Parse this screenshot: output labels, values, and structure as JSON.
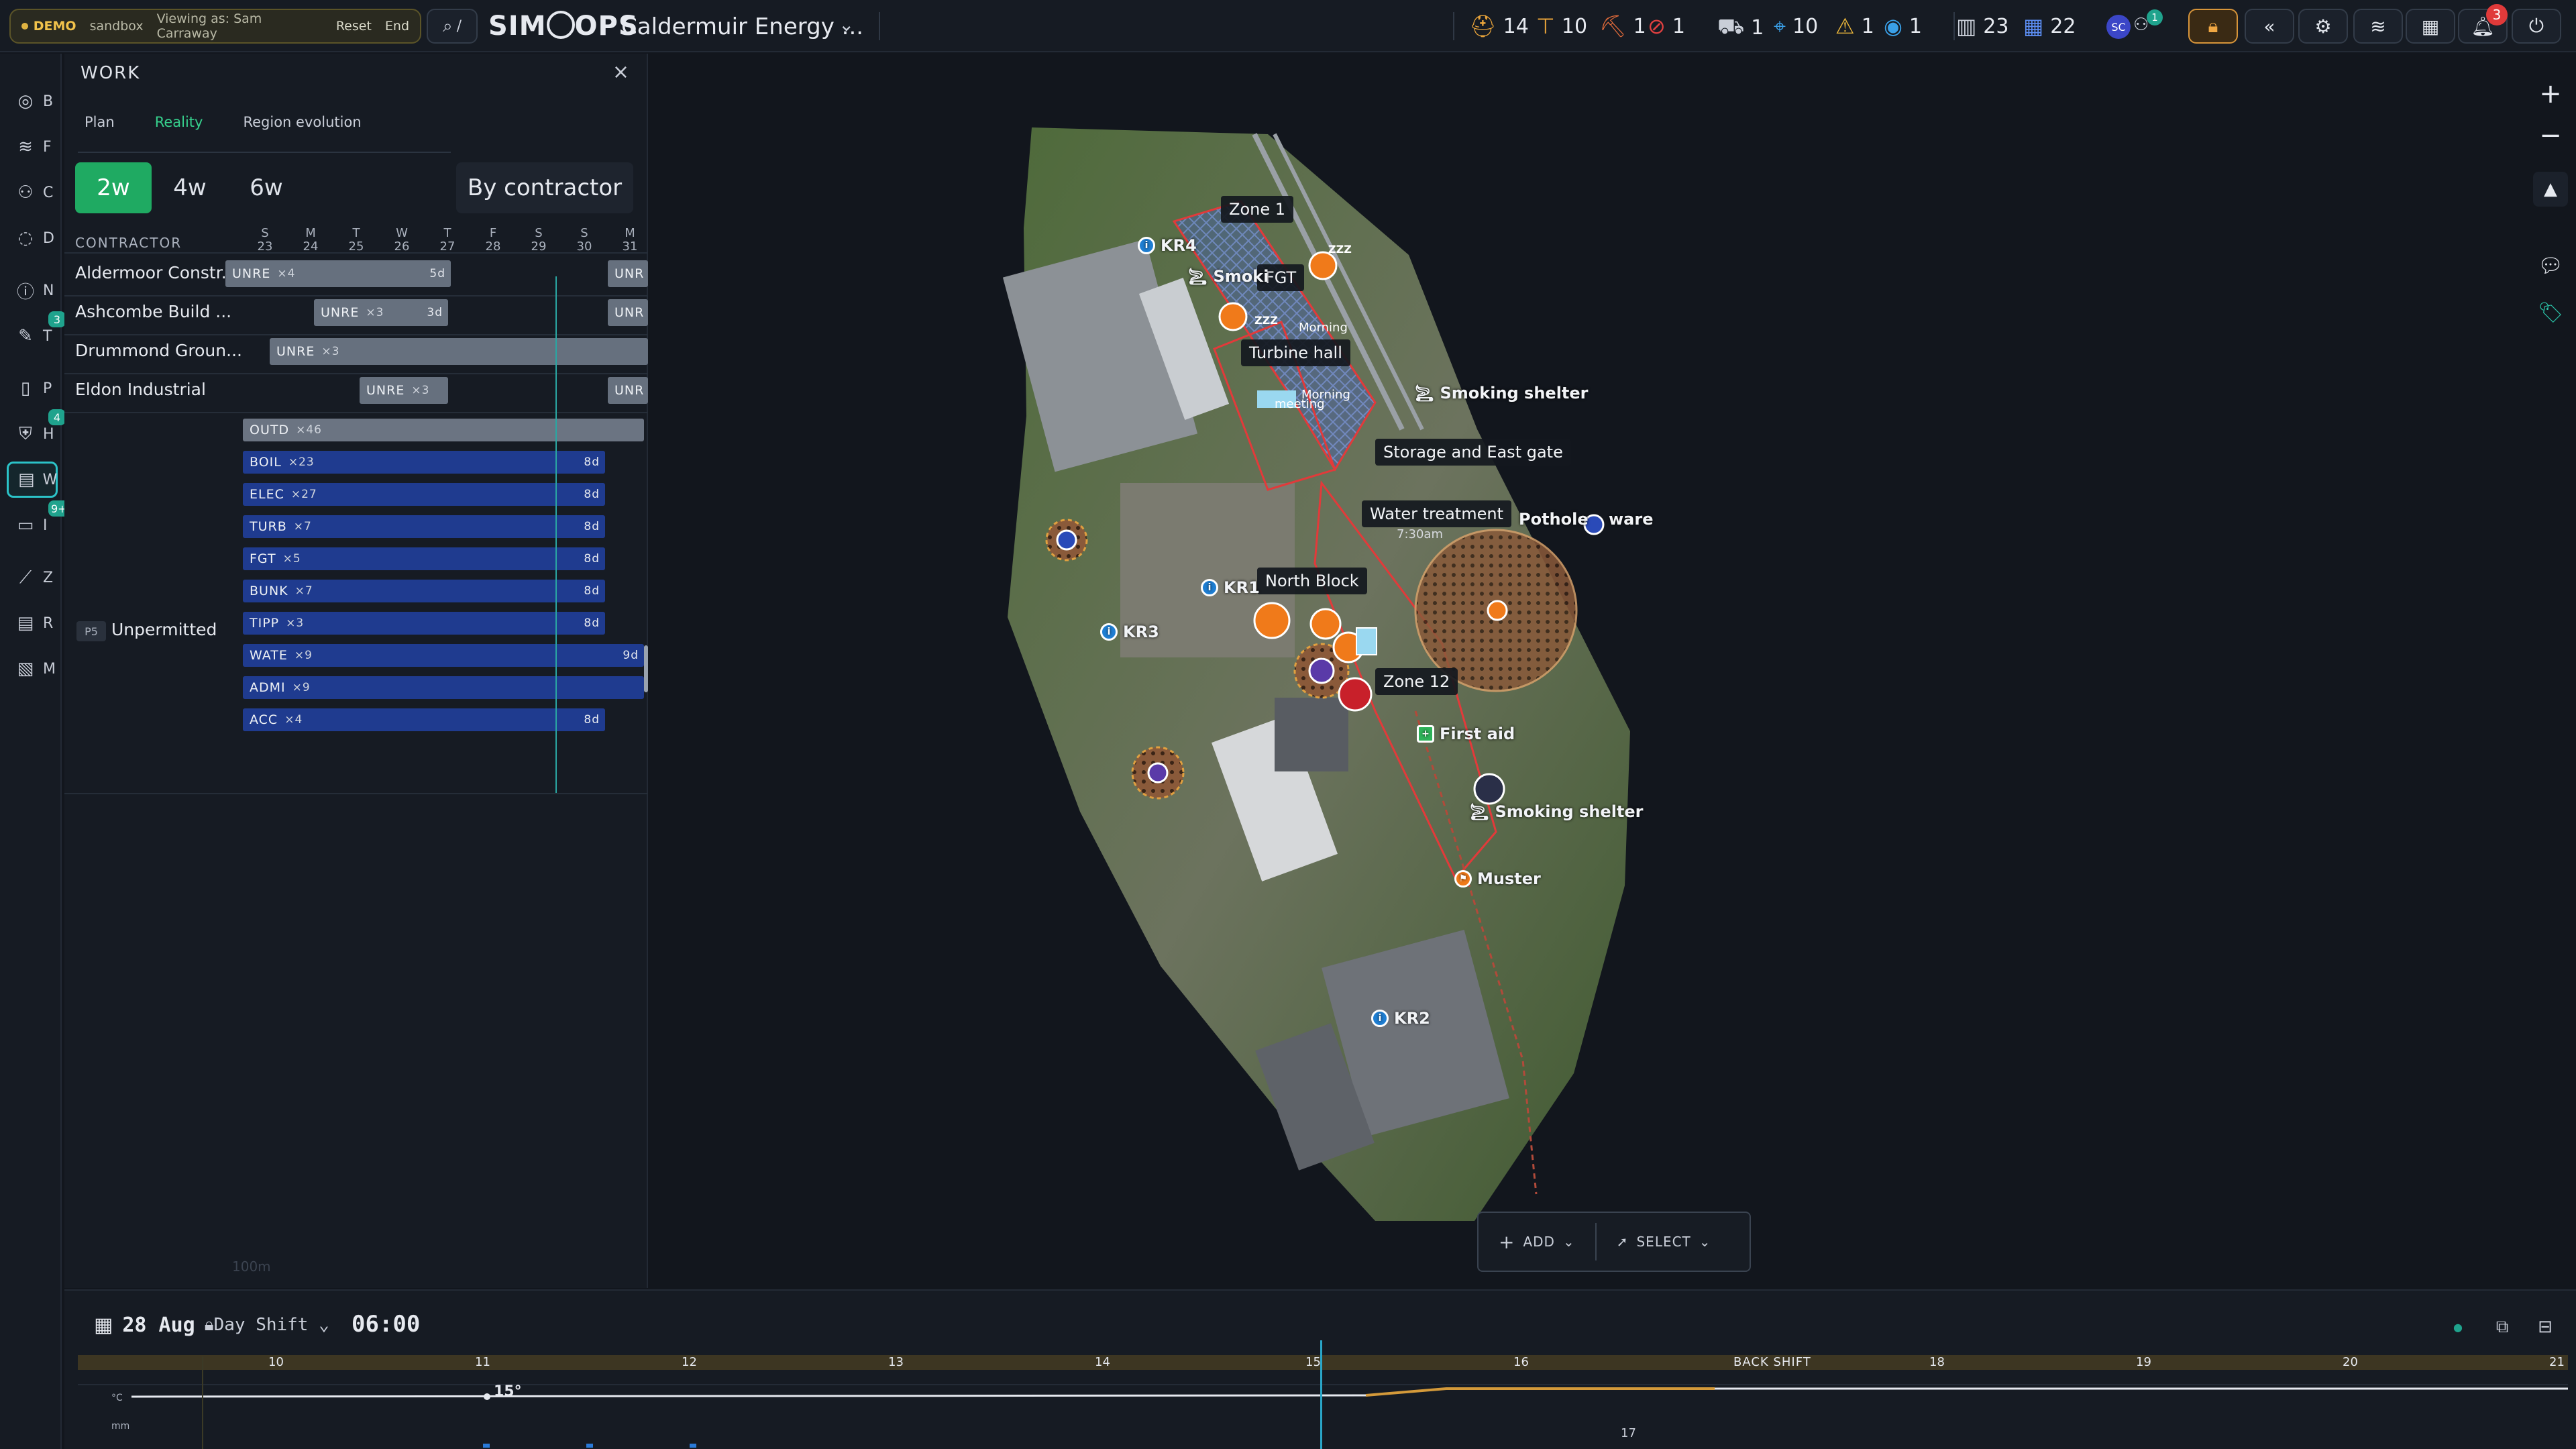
{
  "topbar": {
    "demo": "DEMO",
    "sandbox": "sandbox",
    "viewing_as": "Viewing as: Sam Carraway",
    "reset": "Reset",
    "end": "End",
    "search_shortcut": "/",
    "logo": "SIMOPS",
    "project": "Caldermuir Energy ...",
    "stats": [
      {
        "icon": "hardhat-icon",
        "glyph": "⛑",
        "value": "14",
        "color": "#e8a33a"
      },
      {
        "icon": "crane-icon",
        "glyph": "⊤",
        "value": "10",
        "color": "#e8a33a"
      },
      {
        "icon": "excavator-icon",
        "glyph": "⛏",
        "value": "1",
        "color": "#e06a3a"
      },
      {
        "icon": "prohibited-icon",
        "glyph": "⊘",
        "value": "1",
        "color": "#e04040"
      },
      {
        "icon": "truck-icon",
        "glyph": "⛟",
        "value": "1",
        "color": "#c9ced8"
      },
      {
        "icon": "location-pin-icon",
        "glyph": "⌖",
        "value": "10",
        "color": "#3aa0e8"
      },
      {
        "icon": "warning-icon",
        "glyph": "⚠",
        "value": "1",
        "color": "#e8b43a"
      },
      {
        "icon": "eye-icon",
        "glyph": "◉",
        "value": "1",
        "color": "#3aa0e8"
      },
      {
        "icon": "building-icon",
        "glyph": "▥",
        "value": "23",
        "color": "#c9ced8"
      },
      {
        "icon": "grid-icon",
        "glyph": "▦",
        "value": "22",
        "color": "#5b8cf0"
      }
    ],
    "avatar_initials": "SC",
    "users_badge": "1",
    "notifications_badge": "3"
  },
  "rail": [
    {
      "name": "rail-item-b",
      "letter": "B",
      "glyph": "◎"
    },
    {
      "name": "rail-item-f",
      "letter": "F",
      "glyph": "≋"
    },
    {
      "name": "rail-item-c",
      "letter": "C",
      "glyph": "⚇"
    },
    {
      "name": "rail-item-d",
      "letter": "D",
      "glyph": "◌"
    },
    {
      "name": "rail-item-n",
      "letter": "N",
      "glyph": "ⓘ"
    },
    {
      "name": "rail-item-t",
      "letter": "T",
      "glyph": "✎",
      "badge": "3"
    },
    {
      "name": "rail-item-p",
      "letter": "P",
      "glyph": "▯"
    },
    {
      "name": "rail-item-h",
      "letter": "H",
      "glyph": "⛨",
      "badge": "4"
    },
    {
      "name": "rail-item-w",
      "letter": "W",
      "glyph": "▤",
      "active": true
    },
    {
      "name": "rail-item-i",
      "letter": "I",
      "glyph": "▭",
      "badge": "9+"
    },
    {
      "name": "rail-item-z",
      "letter": "Z",
      "glyph": "⟋"
    },
    {
      "name": "rail-item-r",
      "letter": "R",
      "glyph": "▤"
    },
    {
      "name": "rail-item-m",
      "letter": "M",
      "glyph": "▧"
    }
  ],
  "work": {
    "title": "WORK",
    "tabs": [
      "Plan",
      "Reality",
      "Region evolution"
    ],
    "active_tab": "Reality",
    "ranges": [
      "2w",
      "4w",
      "6w"
    ],
    "active_range": "2w",
    "group_by": "By contractor",
    "contractor_header": "CONTRACTOR",
    "days": [
      {
        "dow": "S",
        "day": "23"
      },
      {
        "dow": "M",
        "day": "24"
      },
      {
        "dow": "T",
        "day": "25"
      },
      {
        "dow": "W",
        "day": "26"
      },
      {
        "dow": "T",
        "day": "27"
      },
      {
        "dow": "F",
        "day": "28"
      },
      {
        "dow": "S",
        "day": "29"
      },
      {
        "dow": "S",
        "day": "30"
      },
      {
        "dow": "M",
        "day": "31"
      }
    ],
    "contractors": [
      {
        "name": "Aldermoor Constr...",
        "bars": [
          {
            "label": "UNRE",
            "count": "×4",
            "dur": "5d"
          },
          {
            "label": "UNR",
            "count": "",
            "dur": ""
          }
        ]
      },
      {
        "name": "Ashcombe Build ...",
        "bars": [
          {
            "label": "UNRE",
            "count": "×3",
            "dur": "3d"
          },
          {
            "label": "UNR",
            "count": "",
            "dur": ""
          }
        ]
      },
      {
        "name": "Drummond Groun...",
        "bars": [
          {
            "label": "UNRE",
            "count": "×3",
            "dur": ""
          }
        ]
      },
      {
        "name": "Eldon Industrial",
        "bars": [
          {
            "label": "UNRE",
            "count": "×3",
            "dur": ""
          },
          {
            "label": "UNR",
            "count": "",
            "dur": ""
          }
        ]
      }
    ],
    "unpermitted": {
      "badge": "P5",
      "label": "Unpermitted",
      "bars": [
        {
          "label": "OUTD",
          "count": "×46",
          "dur": ""
        },
        {
          "label": "BOIL",
          "count": "×23",
          "dur": "8d"
        },
        {
          "label": "ELEC",
          "count": "×27",
          "dur": "8d"
        },
        {
          "label": "TURB",
          "count": "×7",
          "dur": "8d"
        },
        {
          "label": "FGT",
          "count": "×5",
          "dur": "8d"
        },
        {
          "label": "BUNK",
          "count": "×7",
          "dur": "8d"
        },
        {
          "label": "TIPP",
          "count": "×3",
          "dur": "8d"
        },
        {
          "label": "WATE",
          "count": "×9",
          "dur": "9d"
        },
        {
          "label": "ADMI",
          "count": "×9",
          "dur": ""
        },
        {
          "label": "ACC",
          "count": "×4",
          "dur": "8d"
        }
      ]
    },
    "footer_scale": "100m"
  },
  "map": {
    "zones": [
      "Zone 1",
      "FGT",
      "Turbine hall",
      "Storage and East gate",
      "Water treatment",
      "North Block",
      "Zone 12"
    ],
    "pins": [
      {
        "label": "KR4"
      },
      {
        "label": "Smoki"
      },
      {
        "label": "Smoking shelter"
      },
      {
        "label": "Pothole"
      },
      {
        "label": "ware"
      },
      {
        "label": "KR1"
      },
      {
        "label": "KR3"
      },
      {
        "label": "First aid"
      },
      {
        "label": "Smoking shelter"
      },
      {
        "label": "Muster"
      },
      {
        "label": "KR2"
      }
    ],
    "misc_text": [
      "Morning",
      "meeting",
      "Morning",
      "7:30am",
      "ZZZ",
      "ZZZ"
    ],
    "add_label": "ADD",
    "select_label": "SELECT"
  },
  "timeline": {
    "date": "28 Aug",
    "shift": "Day Shift",
    "time": "06:00",
    "hours": [
      "10",
      "11",
      "12",
      "13",
      "14",
      "15",
      "16",
      "18",
      "19",
      "20",
      "21"
    ],
    "back_shift": "BACK SHIFT",
    "temp": "15°",
    "temp_unit": "°C",
    "rain_unit": "mm",
    "marker": "17"
  }
}
